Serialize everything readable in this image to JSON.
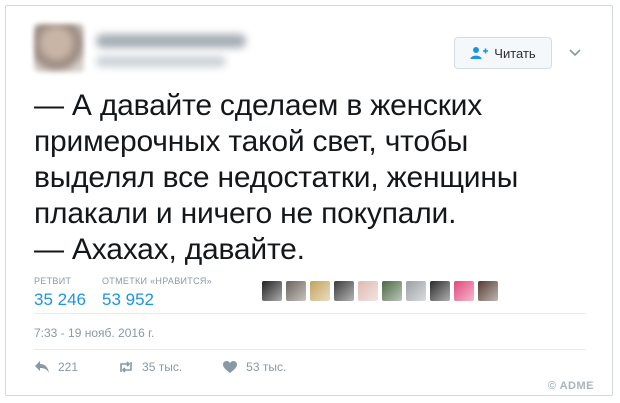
{
  "tweet": {
    "follow_button_label": "Читать",
    "text": "— А давайте сделаем в женских\nпримерочных такой свет, чтобы\nвыделял все недостатки, женщины\nплакали и ничего не покупали.\n— Ахахах, давайте.",
    "stats": {
      "retweets_label": "РЕТВИТ",
      "retweets_value": "35 246",
      "likes_label": "ОТМЕТКИ «НРАВИТСЯ»",
      "likes_value": "53 952"
    },
    "date": "7:33 - 19 нояб. 2016 г.",
    "actions": {
      "replies": "221",
      "retweets": "35 тыс.",
      "likes": "53 тыс."
    }
  },
  "faces": [
    "#222222",
    "#6f6258",
    "#caa34a",
    "#3b3b3b",
    "#e6b7ae",
    "#466b3f",
    "#9aa0a6",
    "#2b2b2b",
    "#ff3d7f",
    "#5a3b2e"
  ],
  "colors": {
    "accent": "#1b95e0",
    "muted": "#8899a6",
    "text": "#14171a"
  },
  "icons": [
    "follow-person-icon",
    "chevron-down-icon",
    "reply-icon",
    "retweet-icon",
    "heart-icon"
  ],
  "watermark": "© ADME"
}
